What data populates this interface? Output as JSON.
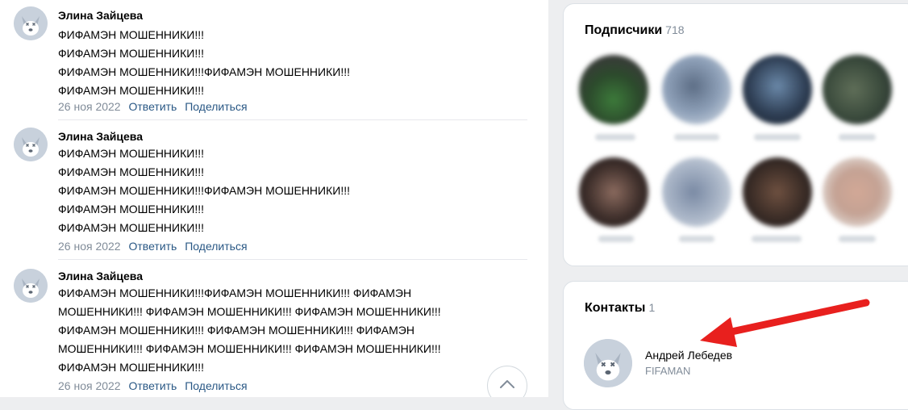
{
  "comments": [
    {
      "author": "Элина Зайцева",
      "text": "ФИФАМЭН МОШЕННИКИ!!!\nФИФАМЭН МОШЕННИКИ!!!\nФИФАМЭН МОШЕННИКИ!!!ФИФАМЭН МОШЕННИКИ!!!\nФИФАМЭН МОШЕННИКИ!!!",
      "date": "26 ноя 2022",
      "reply_label": "Ответить",
      "share_label": "Поделиться"
    },
    {
      "author": "Элина Зайцева",
      "text": "ФИФАМЭН МОШЕННИКИ!!!\nФИФАМЭН МОШЕННИКИ!!!\nФИФАМЭН МОШЕННИКИ!!!ФИФАМЭН МОШЕННИКИ!!!\nФИФАМЭН МОШЕННИКИ!!!\nФИФАМЭН МОШЕННИКИ!!!",
      "date": "26 ноя 2022",
      "reply_label": "Ответить",
      "share_label": "Поделиться"
    },
    {
      "author": "Элина Зайцева",
      "text": "ФИФАМЭН МОШЕННИКИ!!!ФИФАМЭН МОШЕННИКИ!!! ФИФАМЭН\nМОШЕННИКИ!!! ФИФАМЭН МОШЕННИКИ!!! ФИФАМЭН МОШЕННИКИ!!!\nФИФАМЭН МОШЕННИКИ!!! ФИФАМЭН МОШЕННИКИ!!! ФИФАМЭН\nМОШЕННИКИ!!! ФИФАМЭН МОШЕННИКИ!!! ФИФАМЭН МОШЕННИКИ!!!\nФИФАМЭН МОШЕННИКИ!!!",
      "date": "26 ноя 2022",
      "reply_label": "Ответить",
      "share_label": "Поделиться"
    }
  ],
  "subscribers": {
    "title": "Подписчики",
    "count": "718"
  },
  "contacts": {
    "title": "Контакты",
    "count": "1",
    "items": [
      {
        "name": "Андрей Лебедев",
        "subtitle": "FIFAMAN"
      }
    ]
  },
  "colors": {
    "link": "#2a5885",
    "secondary": "#818c99",
    "arrow": "#e8201e",
    "avatar_bg": "#c8d1dc"
  },
  "icons": {
    "default_avatar": "dead-dog-avatar-icon",
    "scroll_up": "chevron-up-icon"
  }
}
